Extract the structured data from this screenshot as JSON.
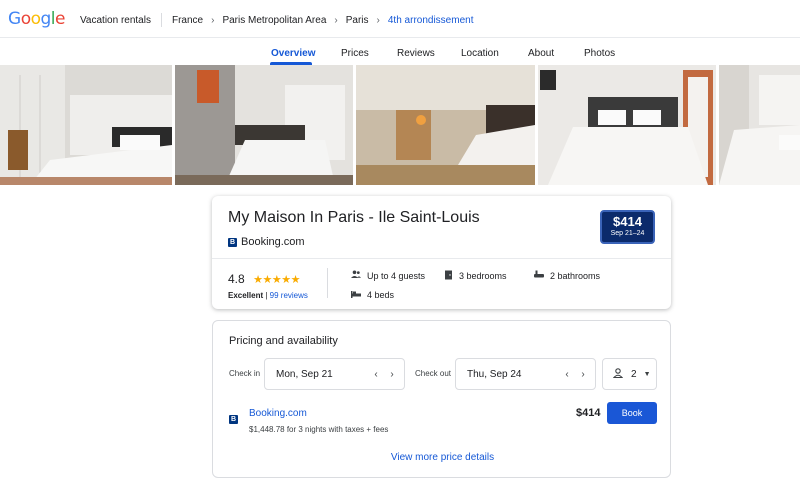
{
  "brand": {
    "name": "Google"
  },
  "breadcrumb": {
    "section": "Vacation rentals",
    "items": [
      "France",
      "Paris Metropolitan Area",
      "Paris"
    ],
    "current": "4th arrondissement"
  },
  "tabs": [
    {
      "label": "Overview",
      "active": true
    },
    {
      "label": "Prices"
    },
    {
      "label": "Reviews"
    },
    {
      "label": "Location"
    },
    {
      "label": "About"
    },
    {
      "label": "Photos"
    }
  ],
  "listing": {
    "title": "My Maison In Paris - Ile Saint-Louis",
    "provider": "Booking.com",
    "provider_mark": "B",
    "price": "$414",
    "dates": "Sep 21–24",
    "rating": "4.8",
    "stars": "★★★★★",
    "rating_label": "Excellent",
    "reviews": "99 reviews",
    "rating_sep": " | ",
    "amenities": {
      "guests": "Up to 4 guests",
      "bedrooms": "3 bedrooms",
      "bathrooms": "2 bathrooms",
      "beds": "4 beds"
    }
  },
  "pricing": {
    "title": "Pricing and availability",
    "checkin_label": "Check in",
    "checkin_value": "Mon, Sep 21",
    "checkout_label": "Check out",
    "checkout_value": "Thu, Sep 24",
    "guests": "2",
    "offer": {
      "provider": "Booking.com",
      "detail": "$1,448.78 for 3 nights with taxes + fees",
      "price": "$414",
      "button": "Book"
    },
    "more_link": "View more price details"
  },
  "colors": {
    "accent": "#1558d6",
    "price_box": "#0b2a6b",
    "star": "#f9ab00",
    "booking": "#003580"
  },
  "icons": {
    "prev": "chevron-left-icon",
    "next": "chevron-right-icon",
    "person": "person-icon",
    "dropdown": "caret-down-icon"
  }
}
